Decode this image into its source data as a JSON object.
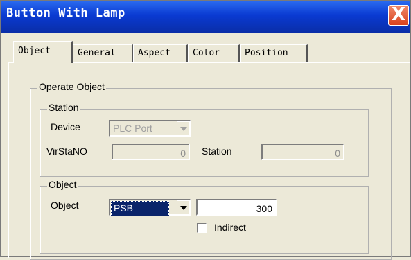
{
  "window": {
    "title": "Button With Lamp",
    "close_label": "X"
  },
  "tabs": [
    "Object",
    "General",
    "Aspect",
    "Color",
    "Position"
  ],
  "operate_object": {
    "title": "Operate Object",
    "station": {
      "title": "Station",
      "device_label": "Device",
      "device_value": "PLC Port",
      "virstano_label": "VirStaNO",
      "virstano_value": "0",
      "station_label": "Station",
      "station_value": "0"
    },
    "object": {
      "title": "Object",
      "object_label": "Object",
      "object_value": "PSB",
      "address_value": "300",
      "indirect_label": "Indirect"
    }
  }
}
